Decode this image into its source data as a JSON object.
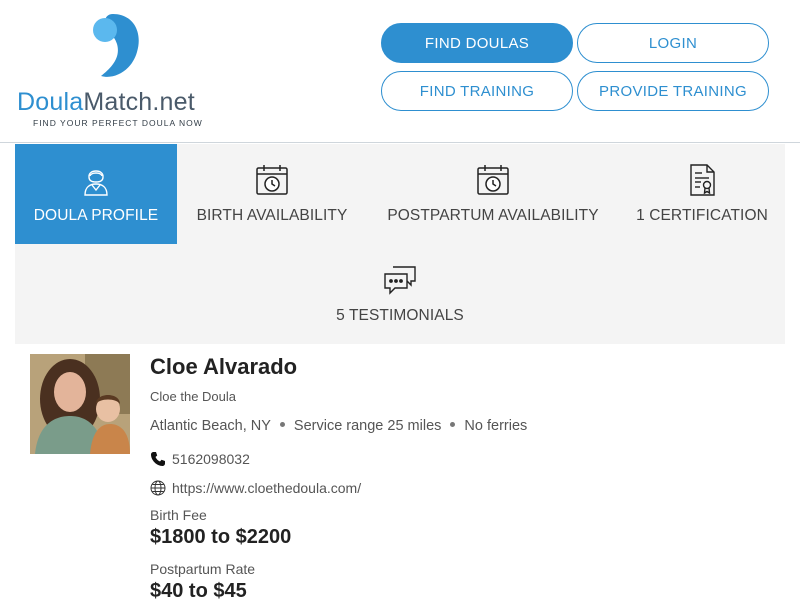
{
  "logo": {
    "name_part1": "Doula",
    "name_part2": "Match.net",
    "tagline": "FIND YOUR PERFECT DOULA NOW",
    "colors": {
      "primary": "#2e8fd0",
      "light": "#5bb8ee"
    }
  },
  "nav": {
    "find_doulas": "FIND DOULAS",
    "login": "LOGIN",
    "find_training": "FIND TRAINING",
    "provide_training": "PROVIDE TRAINING"
  },
  "tabs": [
    {
      "label": "DOULA PROFILE",
      "icon": "doula-person-icon",
      "active": true
    },
    {
      "label": "BIRTH AVAILABILITY",
      "icon": "calendar-clock-icon",
      "active": false
    },
    {
      "label": "POSTPARTUM AVAILABILITY",
      "icon": "calendar-clock-icon",
      "active": false
    },
    {
      "label": "1 CERTIFICATION",
      "icon": "certificate-icon",
      "active": false
    },
    {
      "label": "5 TESTIMONIALS",
      "icon": "chat-bubbles-icon",
      "active": false
    }
  ],
  "profile": {
    "name": "Cloe Alvarado",
    "business": "Cloe the Doula",
    "location": "Atlantic Beach, NY",
    "service_range": "Service range 25 miles",
    "ferries": "No ferries",
    "phone": "5162098032",
    "website": "https://www.cloethedoula.com/",
    "birth_fee_label": "Birth Fee",
    "birth_fee": "$1800 to $2200",
    "postpartum_label": "Postpartum Rate",
    "postpartum_rate": "$40 to $45"
  },
  "colors": {
    "accent": "#2e8fd0",
    "tab_bg": "#f4f4f4"
  }
}
